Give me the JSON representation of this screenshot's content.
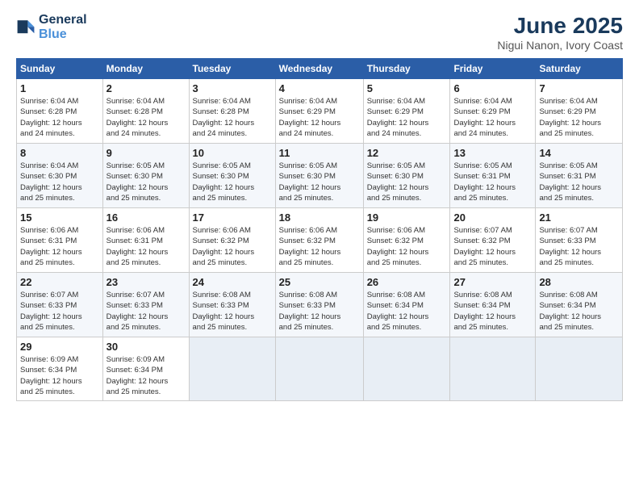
{
  "logo": {
    "line1": "General",
    "line2": "Blue"
  },
  "title": "June 2025",
  "subtitle": "Nigui Nanon, Ivory Coast",
  "days_of_week": [
    "Sunday",
    "Monday",
    "Tuesday",
    "Wednesday",
    "Thursday",
    "Friday",
    "Saturday"
  ],
  "weeks": [
    [
      {
        "day": "1",
        "info": "Sunrise: 6:04 AM\nSunset: 6:28 PM\nDaylight: 12 hours\nand 24 minutes."
      },
      {
        "day": "2",
        "info": "Sunrise: 6:04 AM\nSunset: 6:28 PM\nDaylight: 12 hours\nand 24 minutes."
      },
      {
        "day": "3",
        "info": "Sunrise: 6:04 AM\nSunset: 6:28 PM\nDaylight: 12 hours\nand 24 minutes."
      },
      {
        "day": "4",
        "info": "Sunrise: 6:04 AM\nSunset: 6:29 PM\nDaylight: 12 hours\nand 24 minutes."
      },
      {
        "day": "5",
        "info": "Sunrise: 6:04 AM\nSunset: 6:29 PM\nDaylight: 12 hours\nand 24 minutes."
      },
      {
        "day": "6",
        "info": "Sunrise: 6:04 AM\nSunset: 6:29 PM\nDaylight: 12 hours\nand 24 minutes."
      },
      {
        "day": "7",
        "info": "Sunrise: 6:04 AM\nSunset: 6:29 PM\nDaylight: 12 hours\nand 25 minutes."
      }
    ],
    [
      {
        "day": "8",
        "info": "Sunrise: 6:04 AM\nSunset: 6:30 PM\nDaylight: 12 hours\nand 25 minutes."
      },
      {
        "day": "9",
        "info": "Sunrise: 6:05 AM\nSunset: 6:30 PM\nDaylight: 12 hours\nand 25 minutes."
      },
      {
        "day": "10",
        "info": "Sunrise: 6:05 AM\nSunset: 6:30 PM\nDaylight: 12 hours\nand 25 minutes."
      },
      {
        "day": "11",
        "info": "Sunrise: 6:05 AM\nSunset: 6:30 PM\nDaylight: 12 hours\nand 25 minutes."
      },
      {
        "day": "12",
        "info": "Sunrise: 6:05 AM\nSunset: 6:30 PM\nDaylight: 12 hours\nand 25 minutes."
      },
      {
        "day": "13",
        "info": "Sunrise: 6:05 AM\nSunset: 6:31 PM\nDaylight: 12 hours\nand 25 minutes."
      },
      {
        "day": "14",
        "info": "Sunrise: 6:05 AM\nSunset: 6:31 PM\nDaylight: 12 hours\nand 25 minutes."
      }
    ],
    [
      {
        "day": "15",
        "info": "Sunrise: 6:06 AM\nSunset: 6:31 PM\nDaylight: 12 hours\nand 25 minutes."
      },
      {
        "day": "16",
        "info": "Sunrise: 6:06 AM\nSunset: 6:31 PM\nDaylight: 12 hours\nand 25 minutes."
      },
      {
        "day": "17",
        "info": "Sunrise: 6:06 AM\nSunset: 6:32 PM\nDaylight: 12 hours\nand 25 minutes."
      },
      {
        "day": "18",
        "info": "Sunrise: 6:06 AM\nSunset: 6:32 PM\nDaylight: 12 hours\nand 25 minutes."
      },
      {
        "day": "19",
        "info": "Sunrise: 6:06 AM\nSunset: 6:32 PM\nDaylight: 12 hours\nand 25 minutes."
      },
      {
        "day": "20",
        "info": "Sunrise: 6:07 AM\nSunset: 6:32 PM\nDaylight: 12 hours\nand 25 minutes."
      },
      {
        "day": "21",
        "info": "Sunrise: 6:07 AM\nSunset: 6:33 PM\nDaylight: 12 hours\nand 25 minutes."
      }
    ],
    [
      {
        "day": "22",
        "info": "Sunrise: 6:07 AM\nSunset: 6:33 PM\nDaylight: 12 hours\nand 25 minutes."
      },
      {
        "day": "23",
        "info": "Sunrise: 6:07 AM\nSunset: 6:33 PM\nDaylight: 12 hours\nand 25 minutes."
      },
      {
        "day": "24",
        "info": "Sunrise: 6:08 AM\nSunset: 6:33 PM\nDaylight: 12 hours\nand 25 minutes."
      },
      {
        "day": "25",
        "info": "Sunrise: 6:08 AM\nSunset: 6:33 PM\nDaylight: 12 hours\nand 25 minutes."
      },
      {
        "day": "26",
        "info": "Sunrise: 6:08 AM\nSunset: 6:34 PM\nDaylight: 12 hours\nand 25 minutes."
      },
      {
        "day": "27",
        "info": "Sunrise: 6:08 AM\nSunset: 6:34 PM\nDaylight: 12 hours\nand 25 minutes."
      },
      {
        "day": "28",
        "info": "Sunrise: 6:08 AM\nSunset: 6:34 PM\nDaylight: 12 hours\nand 25 minutes."
      }
    ],
    [
      {
        "day": "29",
        "info": "Sunrise: 6:09 AM\nSunset: 6:34 PM\nDaylight: 12 hours\nand 25 minutes."
      },
      {
        "day": "30",
        "info": "Sunrise: 6:09 AM\nSunset: 6:34 PM\nDaylight: 12 hours\nand 25 minutes."
      },
      {
        "day": "",
        "info": ""
      },
      {
        "day": "",
        "info": ""
      },
      {
        "day": "",
        "info": ""
      },
      {
        "day": "",
        "info": ""
      },
      {
        "day": "",
        "info": ""
      }
    ]
  ]
}
